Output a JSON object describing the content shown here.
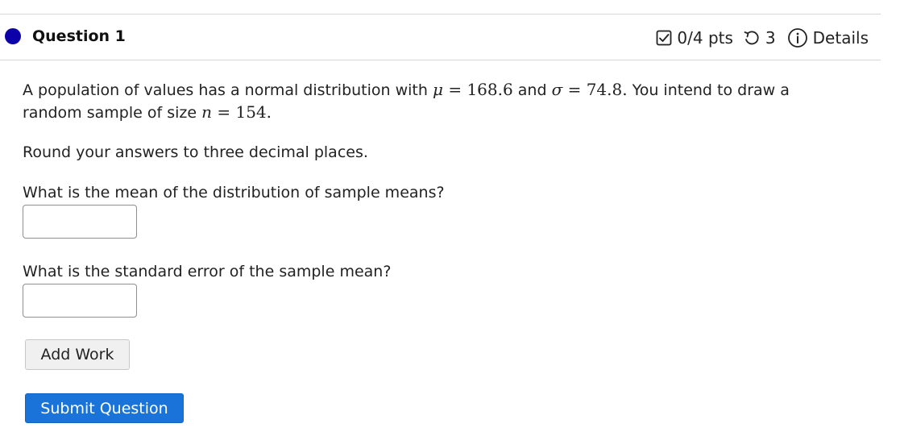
{
  "header": {
    "question_title": "Question 1",
    "points": "0/4 pts",
    "attempts": "3",
    "details_label": "Details",
    "accent_color": "#0c00a8"
  },
  "problem": {
    "intro_prefix": "A population of values has a normal distribution with",
    "mu_symbol": "μ",
    "equals": "=",
    "mu_value": "168.6",
    "and_word": "and",
    "sigma_symbol": "σ",
    "sigma_value": "74.8.",
    "intro_suffix": "You intend to draw a",
    "line2_prefix": "random sample of size",
    "n_symbol": "n",
    "n_value": "154.",
    "instruction": "Round your answers to three decimal places.",
    "q1": "What is the mean of the distribution of sample means?",
    "q2": "What is the standard error of the sample mean?"
  },
  "inputs": {
    "answer1_value": "",
    "answer2_value": ""
  },
  "buttons": {
    "add_work": "Add Work",
    "submit": "Submit Question",
    "submit_color": "#1a73d9"
  },
  "icons": {
    "points": "checkbox-icon",
    "attempts": "retry-icon",
    "details": "info-icon"
  }
}
